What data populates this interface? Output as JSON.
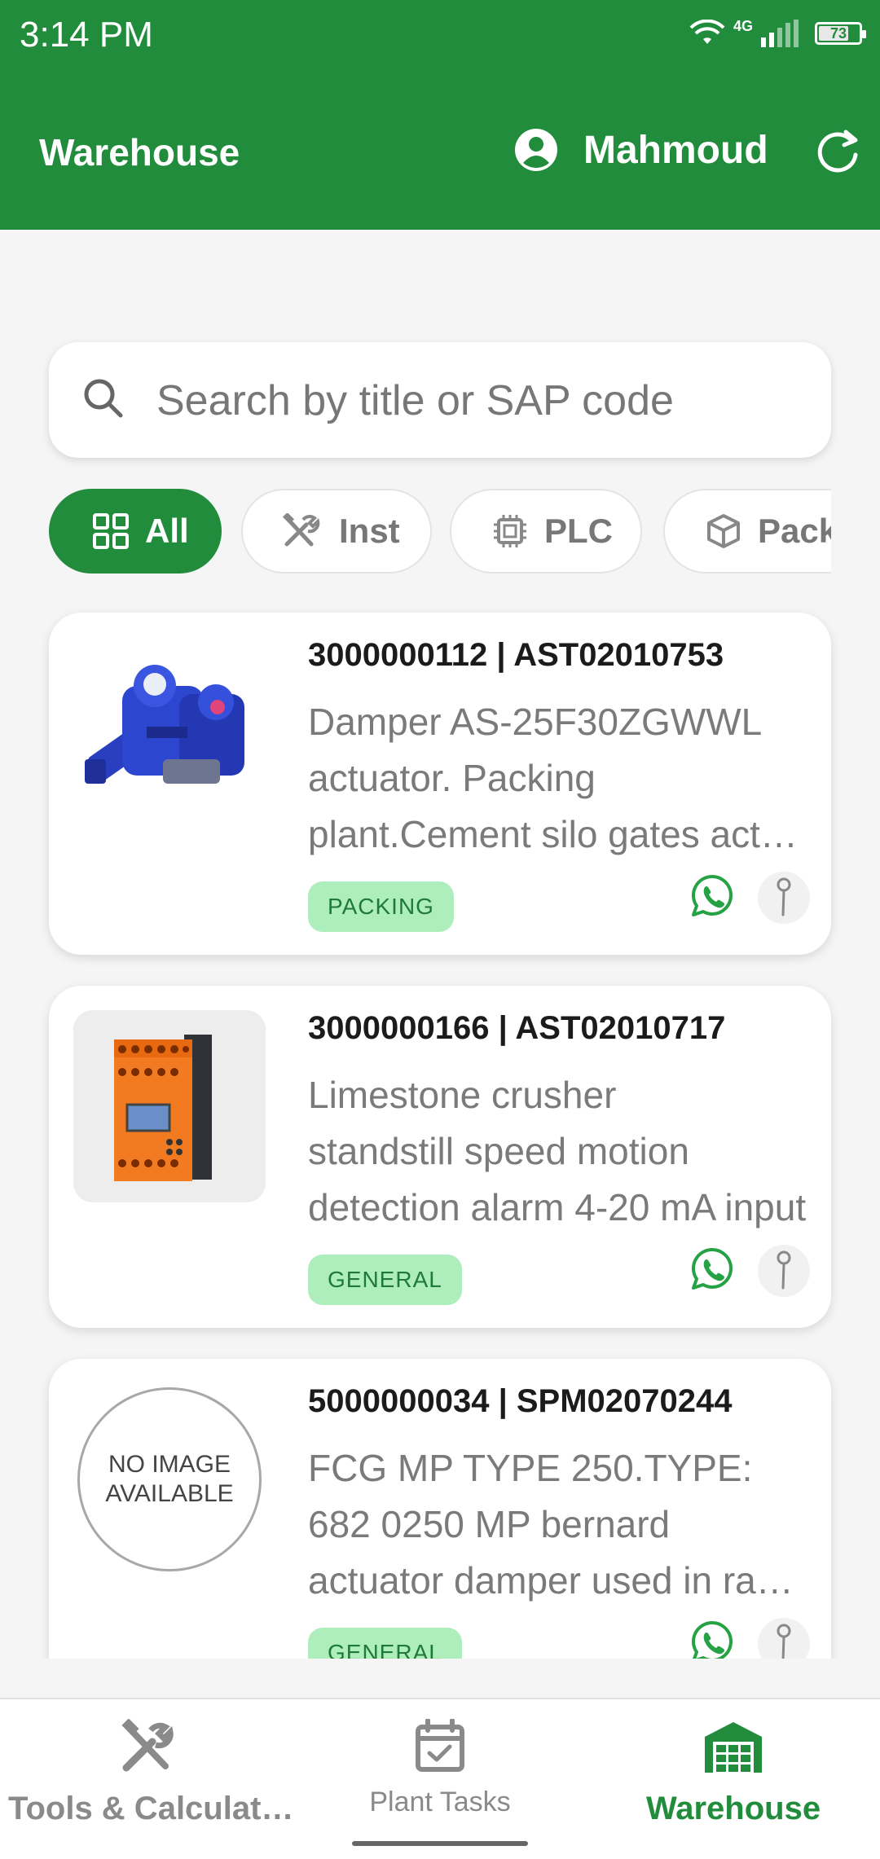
{
  "status_bar": {
    "time": "3:14 PM",
    "network": "4G",
    "battery": "73"
  },
  "app_bar": {
    "title": "Warehouse",
    "user_name": "Mahmoud"
  },
  "search": {
    "placeholder": "Search by title or SAP code"
  },
  "filters": [
    {
      "label": "All",
      "icon": "grid-icon",
      "active": true
    },
    {
      "label": "Inst",
      "icon": "tools-icon",
      "active": false
    },
    {
      "label": "PLC",
      "icon": "chip-icon",
      "active": false
    },
    {
      "label": "Pack",
      "icon": "box-icon",
      "active": false
    }
  ],
  "items": [
    {
      "codes": "3000000112 | AST02010753",
      "description_lines": [
        "Damper AS-25F30ZGWWL",
        "actuator. Packing",
        "plant.Cement silo gates actuator"
      ],
      "badge": "PACKING",
      "image": "blue-actuator-photo"
    },
    {
      "codes": "3000000166 | AST02010717",
      "description_lines": [
        "Limestone crusher",
        "standstill speed motion",
        "detection alarm 4-20 mA  input"
      ],
      "badge": "GENERAL",
      "image": "orange-relay-module-photo"
    },
    {
      "codes": "5000000034 | SPM02070244",
      "description_lines": [
        "FCG MP TYPE 250.TYPE:",
        "682 0250 MP bernard",
        "actuator damper used in raw mill"
      ],
      "badge": "GENERAL",
      "image": "no-image-placeholder",
      "no_image_text": "NO IMAGE\nAVAILABLE"
    }
  ],
  "bottom_nav": [
    {
      "label": "Tools & Calculat…",
      "icon": "tools-icon",
      "active": false
    },
    {
      "label": "Plant Tasks",
      "icon": "calendar-check-icon",
      "active": false
    },
    {
      "label": "Warehouse",
      "icon": "warehouse-icon",
      "active": true
    }
  ],
  "colors": {
    "primary": "#218c3c",
    "badge_bg": "#aeeebd",
    "whatsapp": "#25a244"
  }
}
